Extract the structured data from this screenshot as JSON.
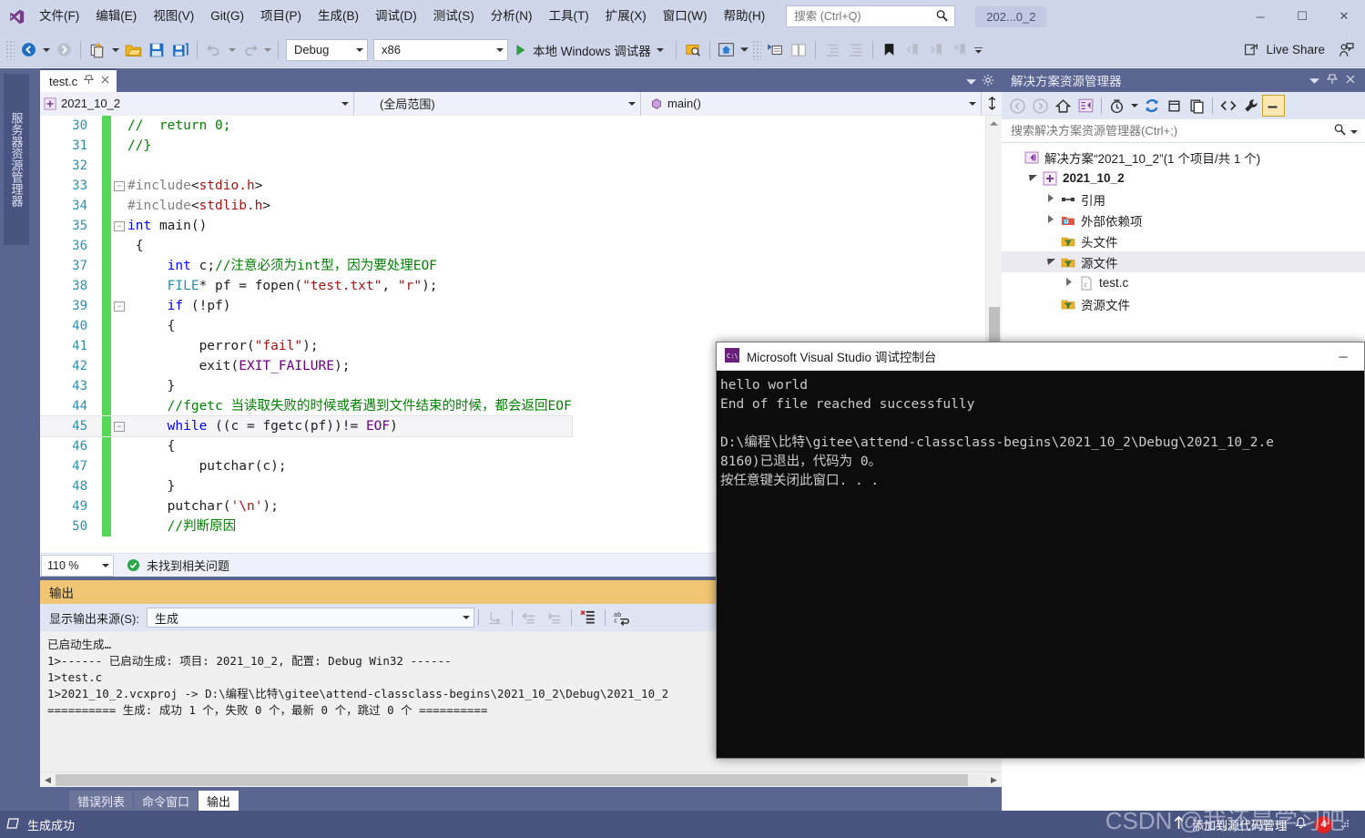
{
  "titlebar": {
    "menus": [
      "文件(F)",
      "编辑(E)",
      "视图(V)",
      "Git(G)",
      "项目(P)",
      "生成(B)",
      "调试(D)",
      "测试(S)",
      "分析(N)",
      "工具(T)",
      "扩展(X)",
      "窗口(W)",
      "帮助(H)"
    ],
    "search_placeholder": "搜索 (Ctrl+Q)",
    "solution_chip": "202...0_2",
    "minimize": "─",
    "maximize": "☐",
    "close": "✕"
  },
  "toolbar": {
    "configuration": "Debug",
    "platform": "x86",
    "run_label": "本地 Windows 调试器",
    "live_share": "Live Share"
  },
  "editor": {
    "tab_label": "test.c",
    "project_combo": "2021_10_2",
    "scope_combo": "(全局范围)",
    "member_combo": "main()",
    "zoom_level": "110 %",
    "issue_status": "未找到相关问题",
    "lines": [
      {
        "num": "30",
        "fold": "",
        "html": "<span class='cm'>//  return 0;</span>"
      },
      {
        "num": "31",
        "fold": "",
        "html": "<span class='cm'>//}</span>"
      },
      {
        "num": "32",
        "fold": "",
        "html": ""
      },
      {
        "num": "33",
        "fold": "-",
        "html": "<span class='pp'>#include</span><span class='id'>&lt;</span><span class='st'>stdio.h</span><span class='id'>&gt;</span>"
      },
      {
        "num": "34",
        "fold": "",
        "html": "<span class='pp'>#include</span><span class='id'>&lt;</span><span class='st'>stdlib.h</span><span class='id'>&gt;</span>"
      },
      {
        "num": "35",
        "fold": "-",
        "html": "<span class='k'>int</span> <span class='id'>main</span><span class='id'>()</span>"
      },
      {
        "num": "36",
        "fold": "",
        "html": " <span class='id'>{</span>"
      },
      {
        "num": "37",
        "fold": "",
        "html": "     <span class='k'>int</span> <span class='id'>c;</span><span class='cm'>//注意必须为int型，因为要处理EOF</span>"
      },
      {
        "num": "38",
        "fold": "",
        "html": "     <span class='ty'>FILE</span><span class='id'>* pf = </span><span class='id'>fopen</span><span class='id'>(</span><span class='st'>\"test.txt\"</span><span class='id'>, </span><span class='st'>\"r\"</span><span class='id'>);</span>"
      },
      {
        "num": "39",
        "fold": "-",
        "html": "     <span class='k'>if</span> <span class='id'>(!pf)</span>"
      },
      {
        "num": "40",
        "fold": "",
        "html": "     <span class='id'>{</span>"
      },
      {
        "num": "41",
        "fold": "",
        "html": "         <span class='id'>perror</span><span class='id'>(</span><span class='st'>\"fail\"</span><span class='id'>);</span>"
      },
      {
        "num": "42",
        "fold": "",
        "html": "         <span class='id'>exit</span><span class='id'>(</span><span class='mac'>EXIT_FAILURE</span><span class='id'>);</span>"
      },
      {
        "num": "43",
        "fold": "",
        "html": "     <span class='id'>}</span>"
      },
      {
        "num": "44",
        "fold": "",
        "html": "     <span class='cm'>//fgetc 当读取失败的时候或者遇到文件结束的时候，都会返回EOF</span>"
      },
      {
        "num": "45",
        "fold": "-",
        "html": "     <span class='k'>while</span> <span class='id'>((c = </span><span class='id'>fgetc</span><span class='id'>(pf))!= </span><span class='mac'>EOF</span><span class='id'>)</span>",
        "highlight": true
      },
      {
        "num": "46",
        "fold": "",
        "html": "     <span class='id'>{</span>"
      },
      {
        "num": "47",
        "fold": "",
        "html": "         <span class='id'>putchar</span><span class='id'>(c);</span>"
      },
      {
        "num": "48",
        "fold": "",
        "html": "     <span class='id'>}</span>"
      },
      {
        "num": "49",
        "fold": "",
        "html": "     <span class='id'>putchar</span><span class='id'>(</span><span class='st'>'\\n'</span><span class='id'>);</span>"
      },
      {
        "num": "50",
        "fold": "",
        "html": "     <span class='cm'>//判断原因</span>"
      }
    ]
  },
  "output": {
    "title": "输出",
    "source_label": "显示输出来源(S):",
    "source_value": "生成",
    "text": "已启动生成…\n1&gt;------ 已启动生成: 项目: 2021_10_2, 配置: Debug Win32 ------\n1&gt;test.c\n1&gt;2021_10_2.vcxproj -&gt; D:\\编程\\比特\\gitee\\attend-classclass-begins\\2021_10_2\\Debug\\2021_10_2\n========== 生成: 成功 1 个，失败 0 个，最新 0 个，跳过 0 个 =========="
  },
  "bottom_tabs": [
    {
      "label": "错误列表",
      "active": false
    },
    {
      "label": "命令窗口",
      "active": false
    },
    {
      "label": "输出",
      "active": true
    }
  ],
  "solution_explorer": {
    "title": "解决方案资源管理器",
    "search_placeholder": "搜索解决方案资源管理器(Ctrl+;)",
    "tree": [
      {
        "level": 0,
        "twisty": "",
        "icon": "solution-icon",
        "label": "解决方案“2021_10_2”(1 个项目/共 1 个)",
        "bold": false
      },
      {
        "level": 1,
        "twisty": "▲",
        "icon": "project-icon",
        "label": "2021_10_2",
        "bold": true
      },
      {
        "level": 2,
        "twisty": "▶",
        "icon": "references-icon",
        "label": "引用",
        "bold": false
      },
      {
        "level": 2,
        "twisty": "▶",
        "icon": "ext-deps-icon",
        "label": "外部依赖项",
        "bold": false
      },
      {
        "level": 2,
        "twisty": "",
        "icon": "filter-icon",
        "label": "头文件",
        "bold": false
      },
      {
        "level": 2,
        "twisty": "▲",
        "icon": "filter-icon",
        "label": "源文件",
        "bold": false,
        "selected": true
      },
      {
        "level": 3,
        "twisty": "▶",
        "icon": "c-file-icon",
        "label": "test.c",
        "bold": false
      },
      {
        "level": 2,
        "twisty": "",
        "icon": "filter-icon",
        "label": "资源文件",
        "bold": false
      }
    ]
  },
  "console": {
    "title": "Microsoft Visual Studio 调试控制台",
    "minimize": "─",
    "text": "hello world\nEnd of file reached successfully\n\nD:\\编程\\比特\\gitee\\attend-classclass-begins\\2021_10_2\\Debug\\2021_10_2.e\n8160)已退出，代码为 0。\n按任意键关闭此窗口. . ."
  },
  "statusbar": {
    "build_result": "生成成功",
    "source_control": "添加到源代码管理",
    "notification_count": "4"
  },
  "server_explorer_tab": "服务器资源管理器",
  "watermark": "CSDN @我还是学习吧",
  "colors": {
    "chrome": "#cfd6ea",
    "dock": "#5b6591",
    "statusbar": "#4a5480",
    "output_header": "#f0c674",
    "console_bg": "#0c0c0c",
    "changed_bar": "#57d757",
    "accent_blue": "#2b91af"
  }
}
